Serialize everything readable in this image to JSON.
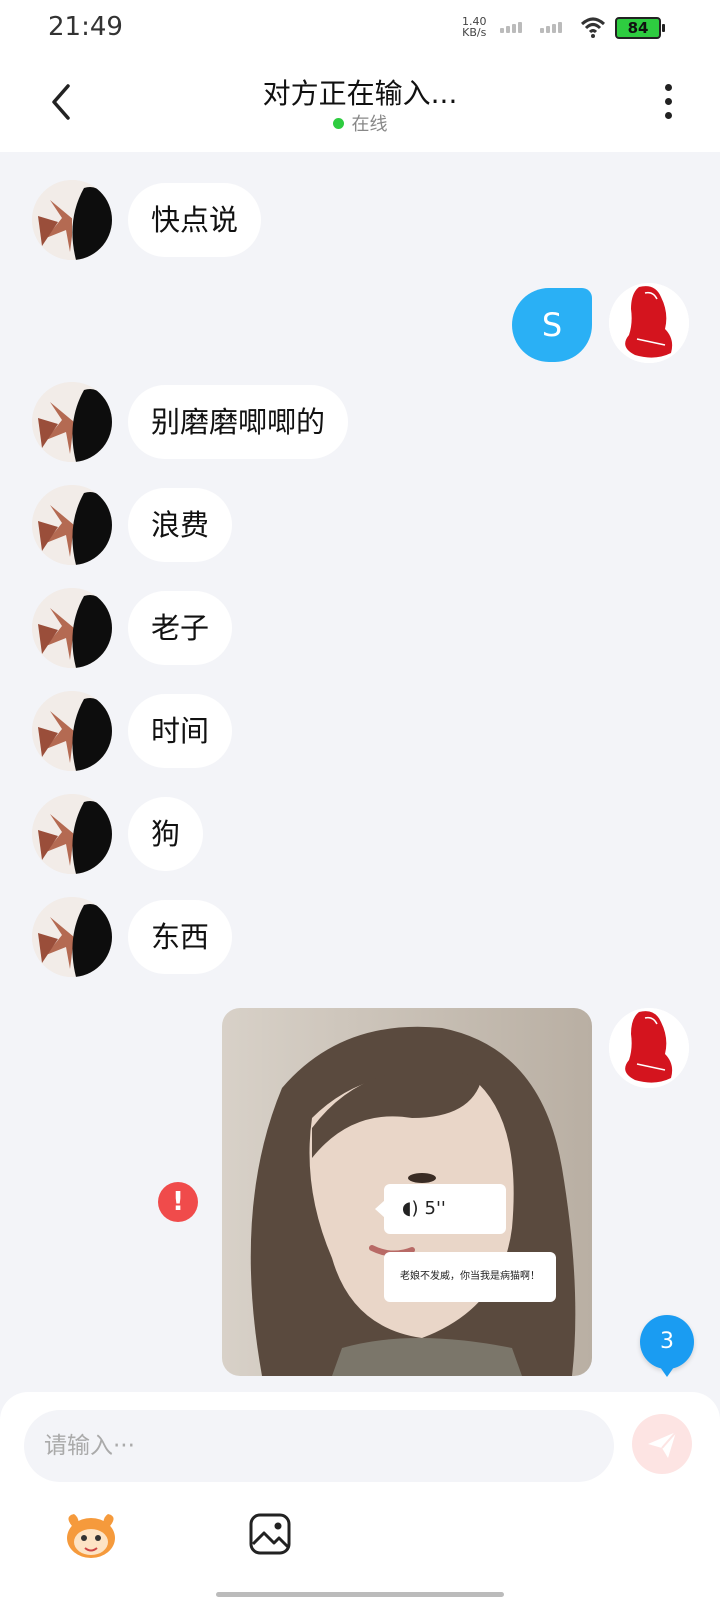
{
  "status_bar": {
    "time": "21:49",
    "net_speed_value": "1.40",
    "net_speed_unit": "KB/s",
    "battery": "84",
    "icons": [
      "signal-icon",
      "signal-icon",
      "wifi-icon",
      "battery-icon"
    ]
  },
  "header": {
    "title": "对方正在输入...",
    "status": "在线",
    "icons": [
      "back-icon",
      "more-icon"
    ]
  },
  "messages": [
    {
      "side": "left",
      "text": "快点说"
    },
    {
      "side": "right",
      "text": "S"
    },
    {
      "side": "left",
      "text": "别磨磨唧唧的"
    },
    {
      "side": "left",
      "text": "浪费"
    },
    {
      "side": "left",
      "text": "老子"
    },
    {
      "side": "left",
      "text": "时间"
    },
    {
      "side": "left",
      "text": "狗"
    },
    {
      "side": "left",
      "text": "东西"
    },
    {
      "side": "right",
      "type": "image",
      "image_voice_duration": "5''",
      "image_caption": "老娘不发威，你当我是病猫啊！",
      "send_failed": true
    }
  ],
  "unread_count": "3",
  "composer": {
    "placeholder": "请输入···",
    "icons": [
      "send-icon",
      "emoji-icon",
      "image-icon"
    ]
  },
  "colors": {
    "sent_bubble": "#2ab0f5",
    "online_dot": "#2ecc40",
    "error": "#f04b4b",
    "badge": "#1a9cf2",
    "background": "#f3f4f8"
  }
}
